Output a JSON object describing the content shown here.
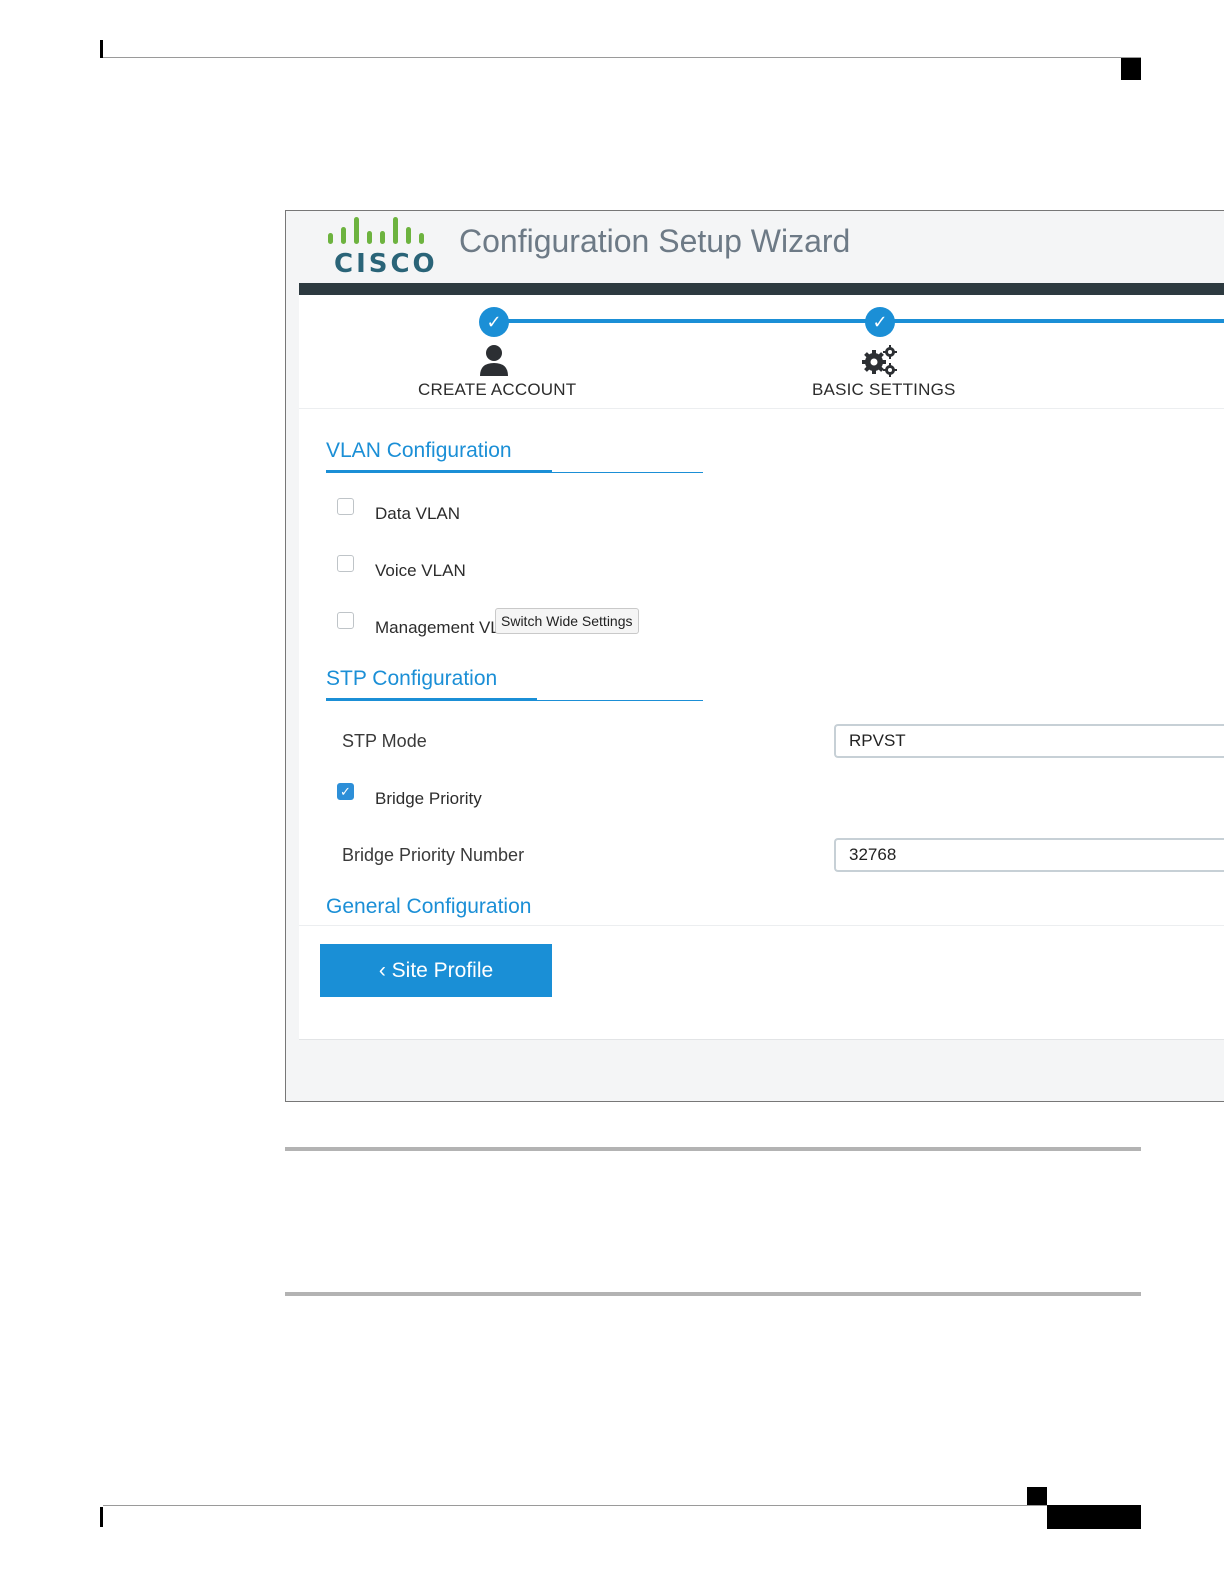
{
  "wizard": {
    "title": "Configuration Setup Wizard",
    "logo_text": "CISCO",
    "steps": [
      {
        "label": "CREATE ACCOUNT",
        "check": "✓",
        "icon": "user-icon"
      },
      {
        "label": "BASIC SETTINGS",
        "check": "✓",
        "icon": "gears-icon"
      }
    ]
  },
  "vlan": {
    "title": "VLAN Configuration",
    "options": [
      {
        "label": "Data VLAN",
        "checked": false
      },
      {
        "label": "Voice VLAN",
        "checked": false
      },
      {
        "label": "Management VL",
        "checked": false
      }
    ]
  },
  "tooltip": "Switch Wide Settings",
  "stp": {
    "title": "STP Configuration",
    "mode_label": "STP Mode",
    "mode_value": "RPVST",
    "bridge_priority_label": "Bridge Priority",
    "bridge_priority_checked": true,
    "bridge_priority_check": "✓",
    "bridge_priority_number_label": "Bridge Priority Number",
    "bridge_priority_number_value": "32768"
  },
  "general": {
    "title": "General Configuration"
  },
  "nav": {
    "back_label": "‹ Site Profile"
  },
  "colors": {
    "accent": "#1b8fd6",
    "header_bar": "#2d3a40",
    "title_gray": "#6d7a86",
    "logo_blue": "#2a6478",
    "logo_green": "#6db33f"
  }
}
